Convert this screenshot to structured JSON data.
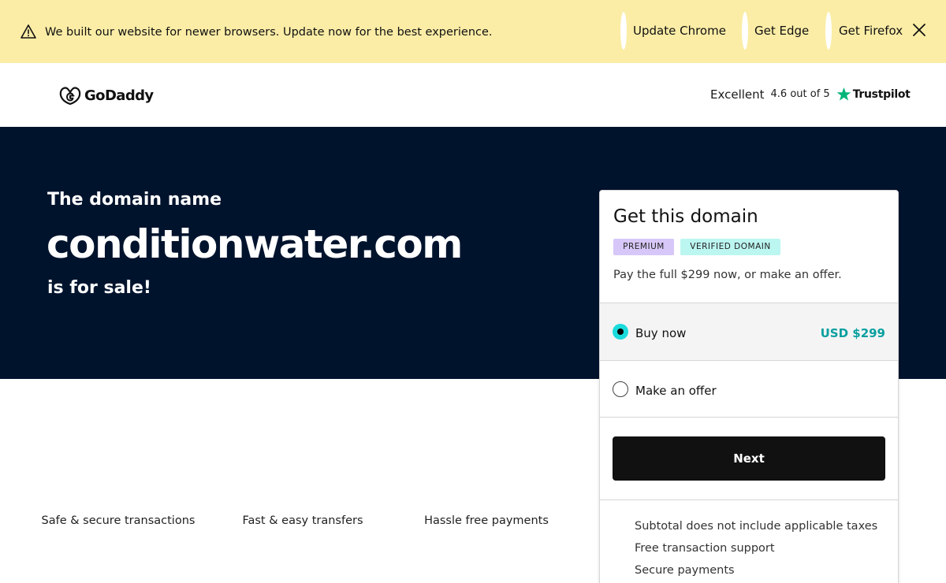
{
  "banner": {
    "message": "We built our website for newer browsers. Update now for the best experience.",
    "links": [
      "Update Chrome",
      "Get Edge",
      "Get Firefox"
    ],
    "warning_icon": "warning-triangle-icon",
    "close_icon": "close-icon"
  },
  "header": {
    "brand": "GoDaddy",
    "trustpilot": {
      "rating_word": "Excellent",
      "score": "4.6 out of 5",
      "brand": "Trustpilot"
    }
  },
  "hero": {
    "pre": "The domain name",
    "domain": "conditionwater.com",
    "post": "is for sale!"
  },
  "features": [
    "Safe & secure transactions",
    "Fast & easy transfers",
    "Hassle free payments"
  ],
  "card": {
    "title": "Get this domain",
    "badges": [
      "PREMIUM",
      "VERIFIED DOMAIN"
    ],
    "description": "Pay the full $299 now, or make an offer.",
    "options": [
      {
        "label": "Buy now",
        "price": "USD $299",
        "selected": true
      },
      {
        "label": "Make an offer",
        "price": "",
        "selected": false
      }
    ],
    "next_label": "Next",
    "notes": [
      "Subtotal does not include applicable taxes",
      "Free transaction support",
      "Secure payments"
    ]
  },
  "colors": {
    "banner_bg": "#fbeda6",
    "hero_bg": "#00132d",
    "accent_teal": "#1bdbdb",
    "price_teal": "#0a9f9f",
    "trustpilot_green": "#00b67a",
    "badge_premium": "#d7c7f8",
    "badge_verified": "#bcf6f1"
  }
}
